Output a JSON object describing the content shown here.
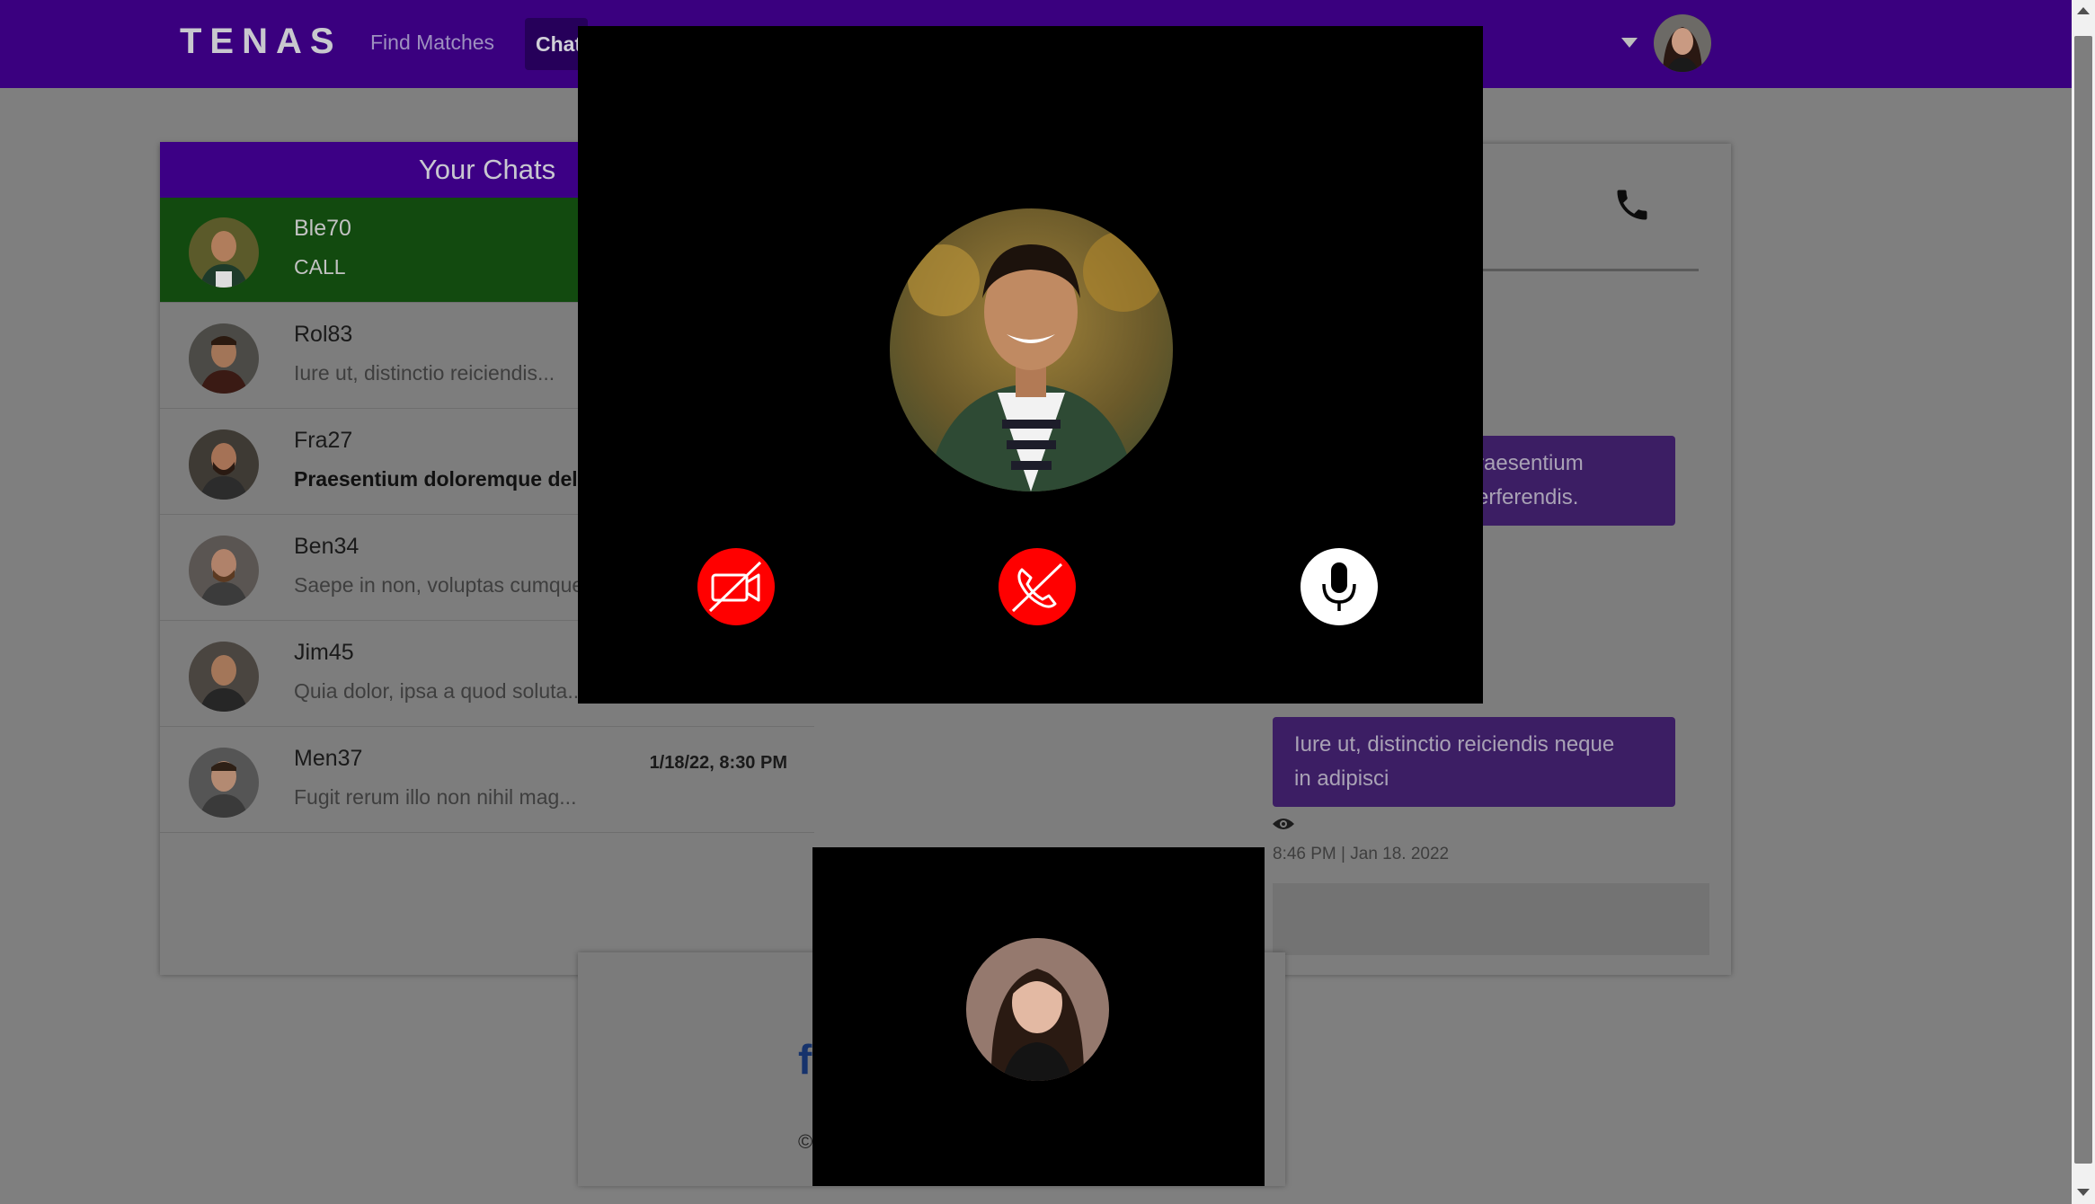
{
  "nav": {
    "logo": "TENAS",
    "find_matches": "Find Matches",
    "chat": "Chat"
  },
  "chats": {
    "title": "Your Chats",
    "items": [
      {
        "name": "Ble70",
        "preview": "CALL",
        "time": ""
      },
      {
        "name": "Rol83",
        "preview": "Iure ut, distinctio reiciendis...",
        "time": ""
      },
      {
        "name": "Fra27",
        "preview": "Praesentium doloremque dele",
        "time": ""
      },
      {
        "name": "Ben34",
        "preview": "Saepe in non, voluptas cumque",
        "time": ""
      },
      {
        "name": "Jim45",
        "preview": "Quia dolor, ipsa a quod soluta...",
        "time": ""
      },
      {
        "name": "Men37",
        "preview": "Fugit rerum illo non nihil mag...",
        "time": "1/18/22, 8:30 PM"
      }
    ]
  },
  "conversation": {
    "msg1_line1": "raesentium",
    "msg1_line2": "erferendis.",
    "msg2_line1": "Iure ut, distinctio reiciendis neque",
    "msg2_line2": "in adipisci",
    "msg2_meta": "8:46 PM | Jan 18. 2022"
  },
  "footer": {
    "fb": "f",
    "copyright": "©"
  },
  "colors": {
    "nav_bg": "#3a007f",
    "call_bg": "#000000",
    "control_red": "#ff0000",
    "control_white": "#ffffff"
  },
  "icons": {
    "video_off": "video-off-icon",
    "hangup": "phone-hangup-icon",
    "mic": "microphone-icon",
    "phone": "phone-icon",
    "seen": "eye-icon"
  }
}
